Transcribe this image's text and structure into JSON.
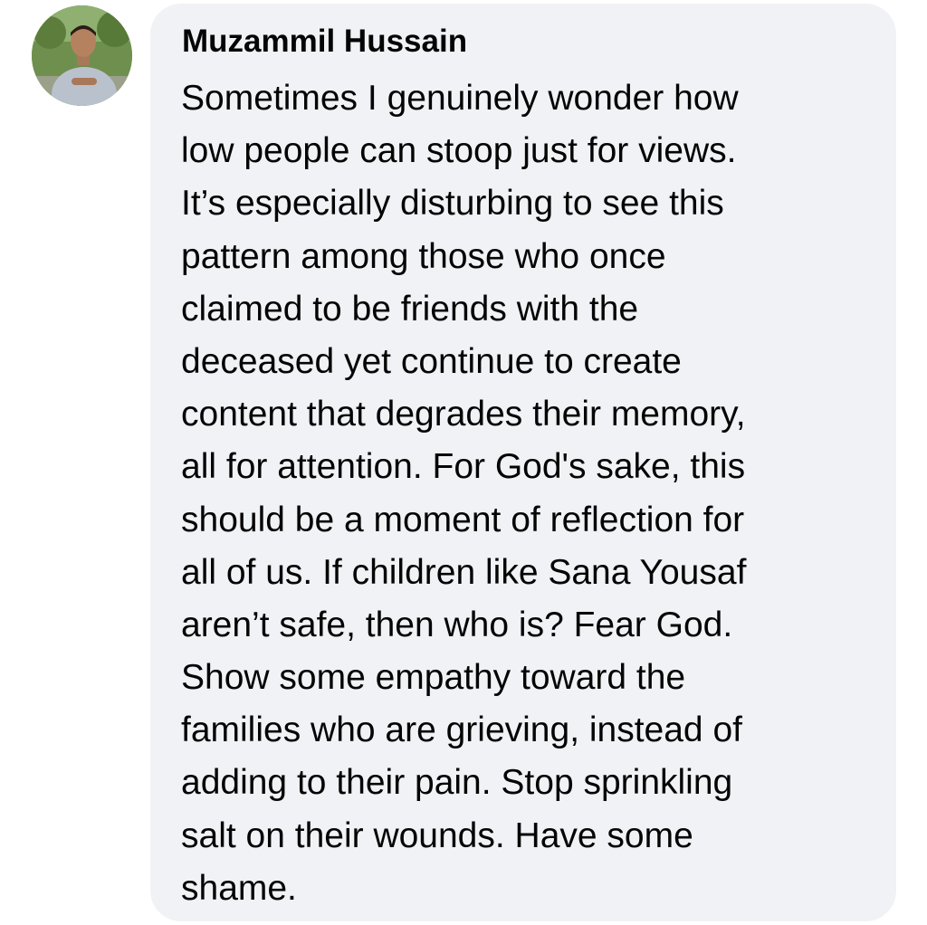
{
  "comment": {
    "author": "Muzammil Hussain",
    "avatar_icon": "user-avatar-photo",
    "bubble_color": "#f0f2f5",
    "text_color": "#050505",
    "lines": [
      "Sometimes I genuinely wonder how",
      "low people can stoop just for views.",
      "It’s especially disturbing to see this",
      "pattern among those who once",
      "claimed to be friends with the",
      "deceased yet continue to create",
      "content that degrades their memory,",
      "all for attention. For God's sake, this",
      "should be a moment of reflection for",
      "all of us. If children like Sana Yousaf",
      "aren’t safe, then who is? Fear God.",
      "Show some empathy toward the",
      "families who are grieving, instead of",
      "adding to their pain. Stop sprinkling",
      "salt on their wounds. Have some",
      "shame."
    ]
  }
}
